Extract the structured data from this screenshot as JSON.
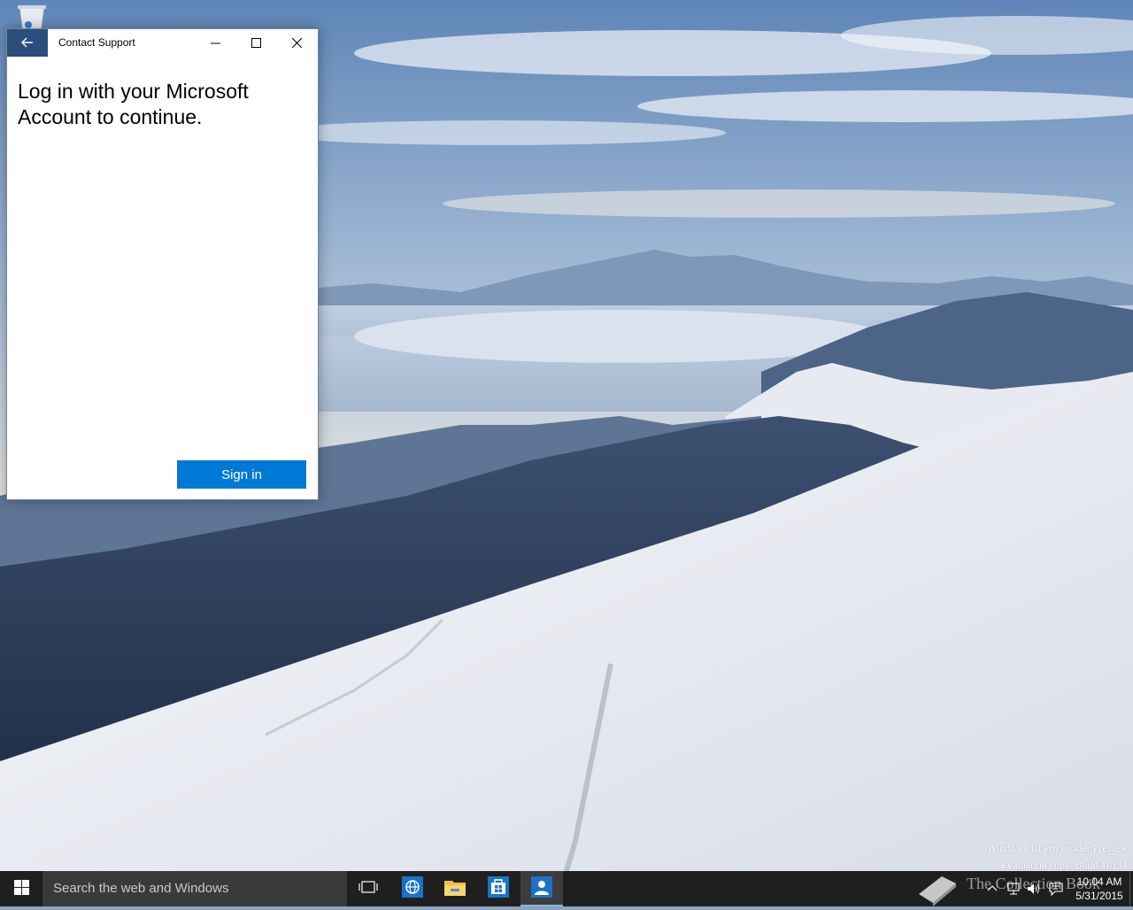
{
  "desktop": {
    "recycle_bin_icon": "recycle-bin-icon"
  },
  "window": {
    "title": "Contact Support",
    "back_icon": "back-arrow-icon",
    "minimize_icon": "minimize-icon",
    "maximize_icon": "maximize-icon",
    "close_icon": "close-icon",
    "heading": "Log in with your Microsoft Account to continue.",
    "sign_in_label": "Sign in",
    "accent_color": "#0078d7",
    "back_button_color": "#2b4f7d"
  },
  "watermark": {
    "line1": "Windows 10 Pro Insider Preview",
    "line2": "Evaluation copy. Build 10134"
  },
  "taskbar": {
    "search_placeholder": "Search the web and Windows",
    "apps": [
      "task-view-icon",
      "edge-browser-icon",
      "file-explorer-icon",
      "store-icon",
      "contact-support-icon"
    ],
    "overlay_text": "The Collection Book",
    "tray_icons": [
      "chevron-up-icon",
      "network-icon",
      "volume-icon",
      "action-center-icon"
    ],
    "time": "10:04 AM",
    "date": "5/31/2015"
  }
}
